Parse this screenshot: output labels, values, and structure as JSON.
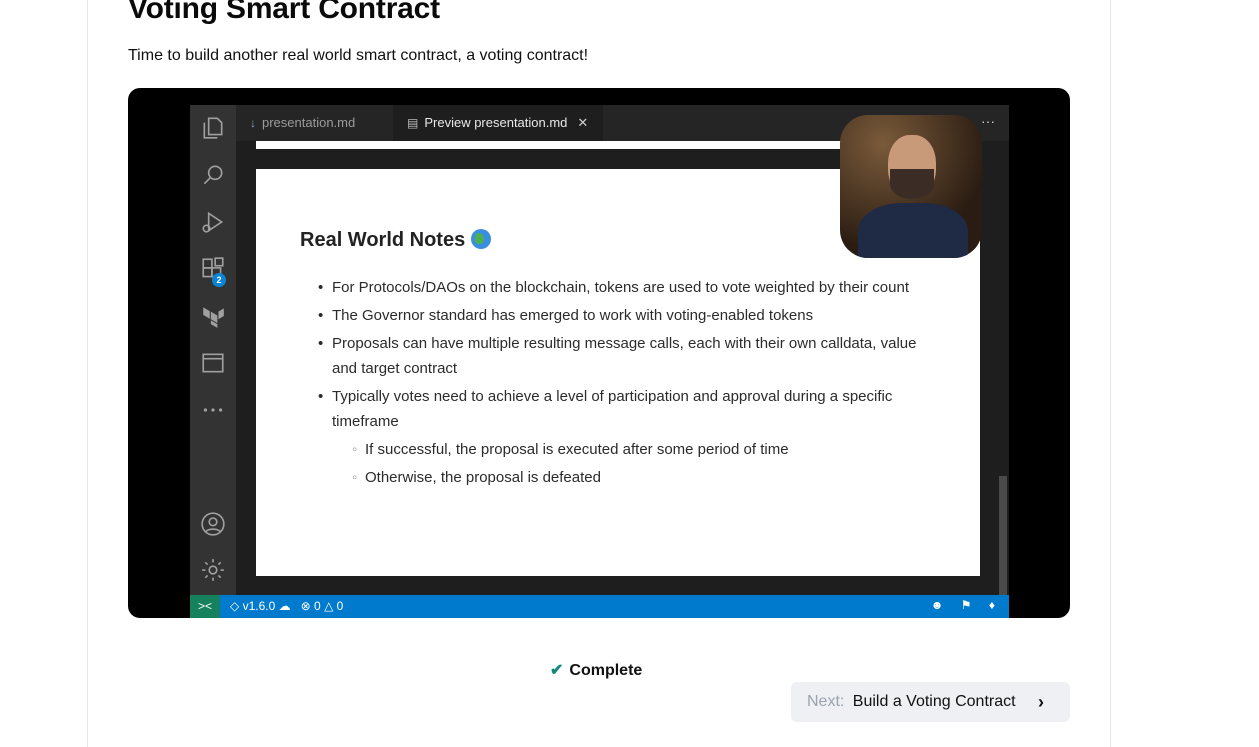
{
  "page": {
    "title": "Voting Smart Contract",
    "subtitle": "Time to build another real world smart contract, a voting contract!"
  },
  "video": {
    "tabs": [
      {
        "label": "presentation.md",
        "active": false
      },
      {
        "label": "Preview presentation.md",
        "active": true
      }
    ],
    "activity_icons": [
      "files-icon",
      "search-icon",
      "run-debug-icon",
      "extensions-icon",
      "terraform-icon",
      "window-icon",
      "more-icon",
      "account-icon",
      "settings-icon"
    ],
    "extensions_badge": "2",
    "slide": {
      "heading": "Real World Notes",
      "bullets": [
        "For Protocols/DAOs on the blockchain, tokens are used to vote weighted by their count",
        "The Governor standard has emerged to work with voting-enabled tokens",
        "Proposals can have multiple resulting message calls, each with their own calldata, value and target contract",
        "Typically votes need to achieve a level of participation and approval during a specific timeframe"
      ],
      "sub_bullets": [
        "If successful, the proposal is executed after some period of time",
        "Otherwise, the proposal is defeated"
      ]
    },
    "status": {
      "version": "v1.6.0",
      "errors": "0",
      "warnings": "0"
    }
  },
  "footer": {
    "complete_label": "Complete",
    "next_prefix": "Next:",
    "next_title": "Build a Voting Contract"
  },
  "colors": {
    "accent_check": "#0f8a7a",
    "statusbar": "#007acc",
    "next_bg": "#eef0f3"
  }
}
